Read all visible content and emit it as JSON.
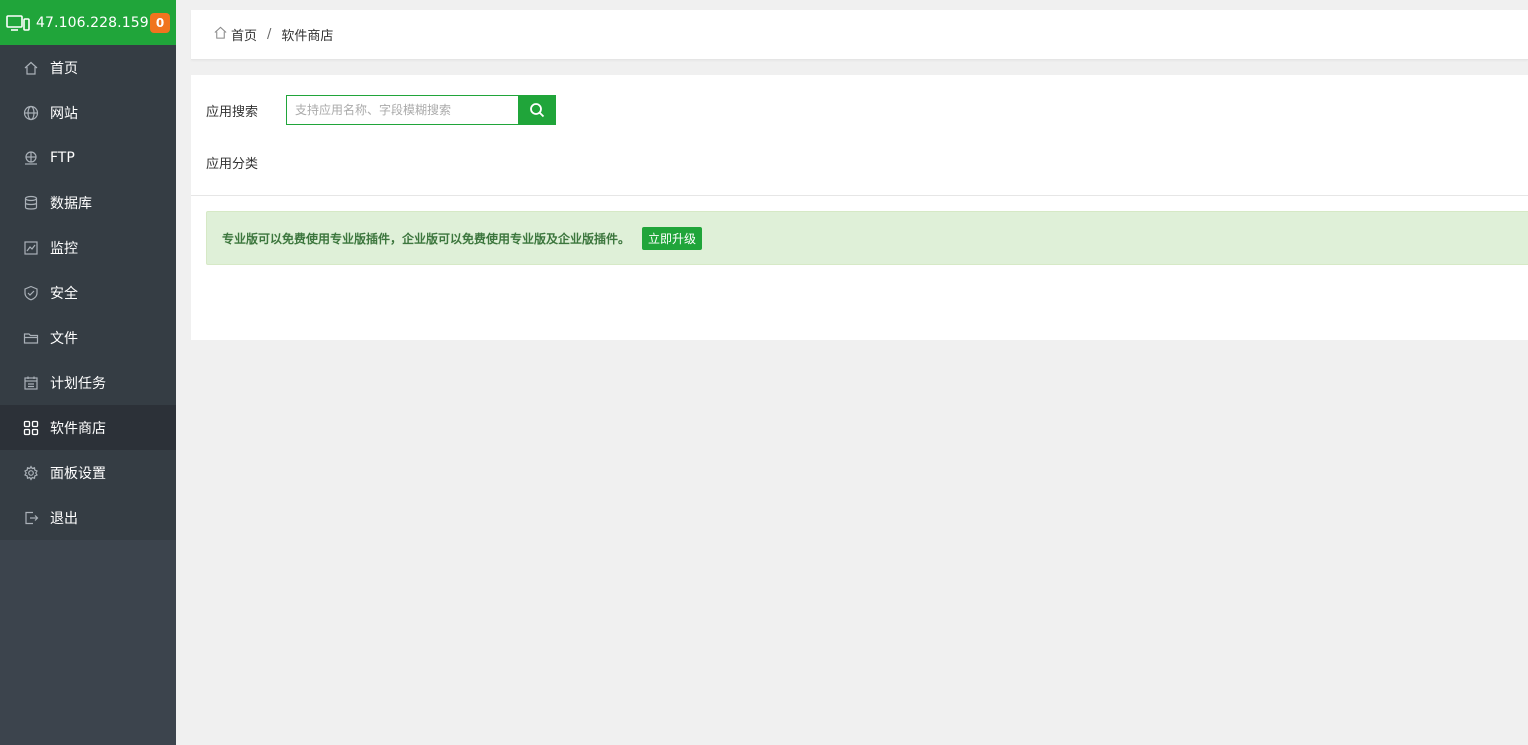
{
  "sidebar": {
    "host_ip": "47.106.228.159",
    "notification_count": "0",
    "items": [
      {
        "label": "首页",
        "icon": "home-icon"
      },
      {
        "label": "网站",
        "icon": "globe-icon"
      },
      {
        "label": "FTP",
        "icon": "ftp-icon"
      },
      {
        "label": "数据库",
        "icon": "database-icon"
      },
      {
        "label": "监控",
        "icon": "monitor-icon"
      },
      {
        "label": "安全",
        "icon": "shield-icon"
      },
      {
        "label": "文件",
        "icon": "folder-icon"
      },
      {
        "label": "计划任务",
        "icon": "calendar-icon"
      },
      {
        "label": "软件商店",
        "icon": "grid-icon"
      },
      {
        "label": "面板设置",
        "icon": "gear-icon"
      },
      {
        "label": "退出",
        "icon": "logout-icon"
      }
    ],
    "active_index": 8
  },
  "breadcrumb": {
    "home": "首页",
    "separator": "/",
    "current": "软件商店"
  },
  "search": {
    "label": "应用搜索",
    "placeholder": "支持应用名称、字段模糊搜索"
  },
  "category": {
    "label": "应用分类"
  },
  "notice": {
    "text": "专业版可以免费使用专业版插件，企业版可以免费使用专业版及企业版插件。",
    "button": "立即升级"
  },
  "colors": {
    "brand": "#20a53a",
    "sidebar_bg": "#3c444d",
    "badge": "#f0741e",
    "alert_bg": "#dff0d8",
    "alert_text": "#3c763d"
  }
}
